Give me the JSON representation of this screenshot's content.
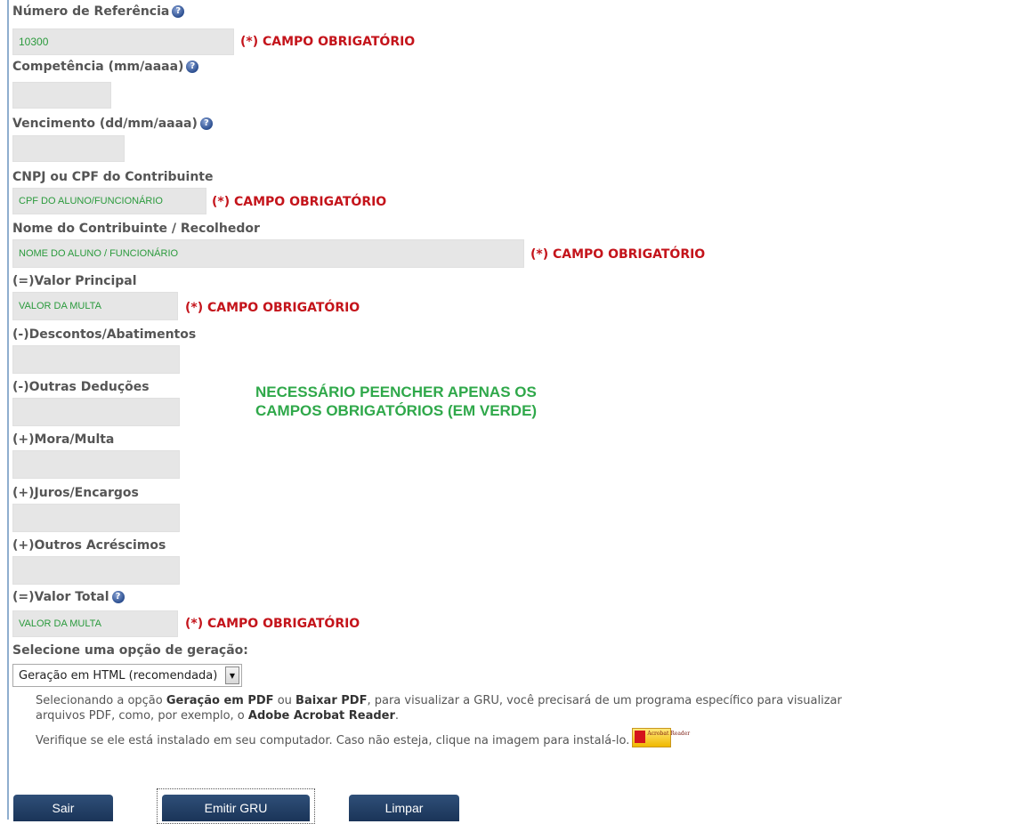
{
  "form": {
    "ref": {
      "label": "Número de Referência",
      "value": "10300",
      "required": "(*) CAMPO OBRIGATÓRIO"
    },
    "competencia": {
      "label": "Competência (mm/aaaa)",
      "value": ""
    },
    "vencimento": {
      "label": "Vencimento (dd/mm/aaaa)",
      "value": ""
    },
    "cnpj": {
      "label": "CNPJ ou CPF do Contribuinte",
      "value": "CPF DO ALUNO/FUNCIONÁRIO",
      "required": "(*) CAMPO OBRIGATÓRIO"
    },
    "nome": {
      "label": "Nome do Contribuinte / Recolhedor",
      "value": "NOME DO ALUNO / FUNCIONÁRIO",
      "required": "(*) CAMPO OBRIGATÓRIO"
    },
    "valor_principal": {
      "label": "(=)Valor Principal",
      "value": "VALOR DA MULTA",
      "required": "(*) CAMPO OBRIGATÓRIO"
    },
    "descontos": {
      "label": "(-)Descontos/Abatimentos",
      "value": ""
    },
    "deducoes": {
      "label": "(-)Outras Deduções",
      "value": ""
    },
    "mora": {
      "label": "(+)Mora/Multa",
      "value": ""
    },
    "juros": {
      "label": "(+)Juros/Encargos",
      "value": ""
    },
    "acrescimos": {
      "label": "(+)Outros Acréscimos",
      "value": ""
    },
    "valor_total": {
      "label": "(=)Valor Total",
      "value": "VALOR DA MULTA",
      "required": "(*) CAMPO OBRIGATÓRIO"
    }
  },
  "note": "NECESSÁRIO PEENCHER APENAS OS CAMPOS OBRIGATÓRIOS (EM VERDE)",
  "generation": {
    "label": "Selecione uma opção de geração:",
    "selected": "Geração em HTML (recomendada)"
  },
  "info": {
    "p1_a": "Selecionando a opção ",
    "p1_b": "Geração em PDF",
    "p1_c": " ou ",
    "p1_d": "Baixar PDF",
    "p1_e": ", para visualizar a GRU, você precisará de um programa específico para visualizar",
    "p1_f": "arquivos PDF, como, por exemplo, o ",
    "p1_g": "Adobe Acrobat Reader",
    "p1_h": ".",
    "p2": "Verifique se ele está instalado em seu computador. Caso não esteja, clique na imagem para instalá-lo.",
    "acrobat_text": "Acrobat Reader"
  },
  "buttons": {
    "sair": "Sair",
    "emitir": "Emitir GRU",
    "limpar": "Limpar"
  },
  "colors": {
    "required": "#c4141b",
    "green": "#2a9a3c",
    "button": "#1f3a60"
  }
}
